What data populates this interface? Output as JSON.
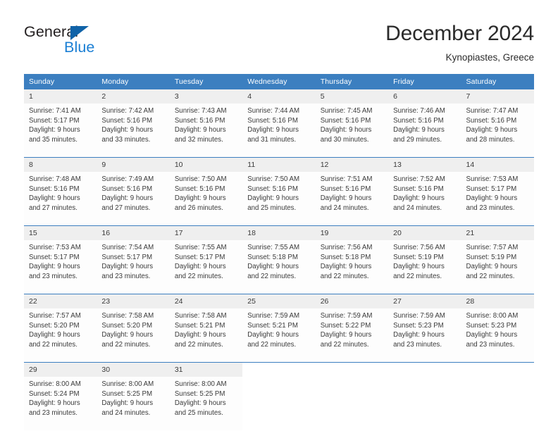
{
  "branding": {
    "name_top": "General",
    "name_bottom": "Blue",
    "accent_color": "#1b7fd4",
    "triangle_color": "#1063a8"
  },
  "header": {
    "title": "December 2024",
    "subtitle": "Kynopiastes, Greece"
  },
  "calendar": {
    "header_color": "#3c7fc0",
    "daynum_bg": "#efefef",
    "weekdays": [
      "Sunday",
      "Monday",
      "Tuesday",
      "Wednesday",
      "Thursday",
      "Friday",
      "Saturday"
    ],
    "weeks": [
      [
        {
          "day": "1",
          "sunrise": "Sunrise: 7:41 AM",
          "sunset": "Sunset: 5:17 PM",
          "daylight1": "Daylight: 9 hours",
          "daylight2": "and 35 minutes."
        },
        {
          "day": "2",
          "sunrise": "Sunrise: 7:42 AM",
          "sunset": "Sunset: 5:16 PM",
          "daylight1": "Daylight: 9 hours",
          "daylight2": "and 33 minutes."
        },
        {
          "day": "3",
          "sunrise": "Sunrise: 7:43 AM",
          "sunset": "Sunset: 5:16 PM",
          "daylight1": "Daylight: 9 hours",
          "daylight2": "and 32 minutes."
        },
        {
          "day": "4",
          "sunrise": "Sunrise: 7:44 AM",
          "sunset": "Sunset: 5:16 PM",
          "daylight1": "Daylight: 9 hours",
          "daylight2": "and 31 minutes."
        },
        {
          "day": "5",
          "sunrise": "Sunrise: 7:45 AM",
          "sunset": "Sunset: 5:16 PM",
          "daylight1": "Daylight: 9 hours",
          "daylight2": "and 30 minutes."
        },
        {
          "day": "6",
          "sunrise": "Sunrise: 7:46 AM",
          "sunset": "Sunset: 5:16 PM",
          "daylight1": "Daylight: 9 hours",
          "daylight2": "and 29 minutes."
        },
        {
          "day": "7",
          "sunrise": "Sunrise: 7:47 AM",
          "sunset": "Sunset: 5:16 PM",
          "daylight1": "Daylight: 9 hours",
          "daylight2": "and 28 minutes."
        }
      ],
      [
        {
          "day": "8",
          "sunrise": "Sunrise: 7:48 AM",
          "sunset": "Sunset: 5:16 PM",
          "daylight1": "Daylight: 9 hours",
          "daylight2": "and 27 minutes."
        },
        {
          "day": "9",
          "sunrise": "Sunrise: 7:49 AM",
          "sunset": "Sunset: 5:16 PM",
          "daylight1": "Daylight: 9 hours",
          "daylight2": "and 27 minutes."
        },
        {
          "day": "10",
          "sunrise": "Sunrise: 7:50 AM",
          "sunset": "Sunset: 5:16 PM",
          "daylight1": "Daylight: 9 hours",
          "daylight2": "and 26 minutes."
        },
        {
          "day": "11",
          "sunrise": "Sunrise: 7:50 AM",
          "sunset": "Sunset: 5:16 PM",
          "daylight1": "Daylight: 9 hours",
          "daylight2": "and 25 minutes."
        },
        {
          "day": "12",
          "sunrise": "Sunrise: 7:51 AM",
          "sunset": "Sunset: 5:16 PM",
          "daylight1": "Daylight: 9 hours",
          "daylight2": "and 24 minutes."
        },
        {
          "day": "13",
          "sunrise": "Sunrise: 7:52 AM",
          "sunset": "Sunset: 5:16 PM",
          "daylight1": "Daylight: 9 hours",
          "daylight2": "and 24 minutes."
        },
        {
          "day": "14",
          "sunrise": "Sunrise: 7:53 AM",
          "sunset": "Sunset: 5:17 PM",
          "daylight1": "Daylight: 9 hours",
          "daylight2": "and 23 minutes."
        }
      ],
      [
        {
          "day": "15",
          "sunrise": "Sunrise: 7:53 AM",
          "sunset": "Sunset: 5:17 PM",
          "daylight1": "Daylight: 9 hours",
          "daylight2": "and 23 minutes."
        },
        {
          "day": "16",
          "sunrise": "Sunrise: 7:54 AM",
          "sunset": "Sunset: 5:17 PM",
          "daylight1": "Daylight: 9 hours",
          "daylight2": "and 23 minutes."
        },
        {
          "day": "17",
          "sunrise": "Sunrise: 7:55 AM",
          "sunset": "Sunset: 5:17 PM",
          "daylight1": "Daylight: 9 hours",
          "daylight2": "and 22 minutes."
        },
        {
          "day": "18",
          "sunrise": "Sunrise: 7:55 AM",
          "sunset": "Sunset: 5:18 PM",
          "daylight1": "Daylight: 9 hours",
          "daylight2": "and 22 minutes."
        },
        {
          "day": "19",
          "sunrise": "Sunrise: 7:56 AM",
          "sunset": "Sunset: 5:18 PM",
          "daylight1": "Daylight: 9 hours",
          "daylight2": "and 22 minutes."
        },
        {
          "day": "20",
          "sunrise": "Sunrise: 7:56 AM",
          "sunset": "Sunset: 5:19 PM",
          "daylight1": "Daylight: 9 hours",
          "daylight2": "and 22 minutes."
        },
        {
          "day": "21",
          "sunrise": "Sunrise: 7:57 AM",
          "sunset": "Sunset: 5:19 PM",
          "daylight1": "Daylight: 9 hours",
          "daylight2": "and 22 minutes."
        }
      ],
      [
        {
          "day": "22",
          "sunrise": "Sunrise: 7:57 AM",
          "sunset": "Sunset: 5:20 PM",
          "daylight1": "Daylight: 9 hours",
          "daylight2": "and 22 minutes."
        },
        {
          "day": "23",
          "sunrise": "Sunrise: 7:58 AM",
          "sunset": "Sunset: 5:20 PM",
          "daylight1": "Daylight: 9 hours",
          "daylight2": "and 22 minutes."
        },
        {
          "day": "24",
          "sunrise": "Sunrise: 7:58 AM",
          "sunset": "Sunset: 5:21 PM",
          "daylight1": "Daylight: 9 hours",
          "daylight2": "and 22 minutes."
        },
        {
          "day": "25",
          "sunrise": "Sunrise: 7:59 AM",
          "sunset": "Sunset: 5:21 PM",
          "daylight1": "Daylight: 9 hours",
          "daylight2": "and 22 minutes."
        },
        {
          "day": "26",
          "sunrise": "Sunrise: 7:59 AM",
          "sunset": "Sunset: 5:22 PM",
          "daylight1": "Daylight: 9 hours",
          "daylight2": "and 22 minutes."
        },
        {
          "day": "27",
          "sunrise": "Sunrise: 7:59 AM",
          "sunset": "Sunset: 5:23 PM",
          "daylight1": "Daylight: 9 hours",
          "daylight2": "and 23 minutes."
        },
        {
          "day": "28",
          "sunrise": "Sunrise: 8:00 AM",
          "sunset": "Sunset: 5:23 PM",
          "daylight1": "Daylight: 9 hours",
          "daylight2": "and 23 minutes."
        }
      ],
      [
        {
          "day": "29",
          "sunrise": "Sunrise: 8:00 AM",
          "sunset": "Sunset: 5:24 PM",
          "daylight1": "Daylight: 9 hours",
          "daylight2": "and 23 minutes."
        },
        {
          "day": "30",
          "sunrise": "Sunrise: 8:00 AM",
          "sunset": "Sunset: 5:25 PM",
          "daylight1": "Daylight: 9 hours",
          "daylight2": "and 24 minutes."
        },
        {
          "day": "31",
          "sunrise": "Sunrise: 8:00 AM",
          "sunset": "Sunset: 5:25 PM",
          "daylight1": "Daylight: 9 hours",
          "daylight2": "and 25 minutes."
        },
        {
          "day": "",
          "sunrise": "",
          "sunset": "",
          "daylight1": "",
          "daylight2": ""
        },
        {
          "day": "",
          "sunrise": "",
          "sunset": "",
          "daylight1": "",
          "daylight2": ""
        },
        {
          "day": "",
          "sunrise": "",
          "sunset": "",
          "daylight1": "",
          "daylight2": ""
        },
        {
          "day": "",
          "sunrise": "",
          "sunset": "",
          "daylight1": "",
          "daylight2": ""
        }
      ]
    ]
  }
}
